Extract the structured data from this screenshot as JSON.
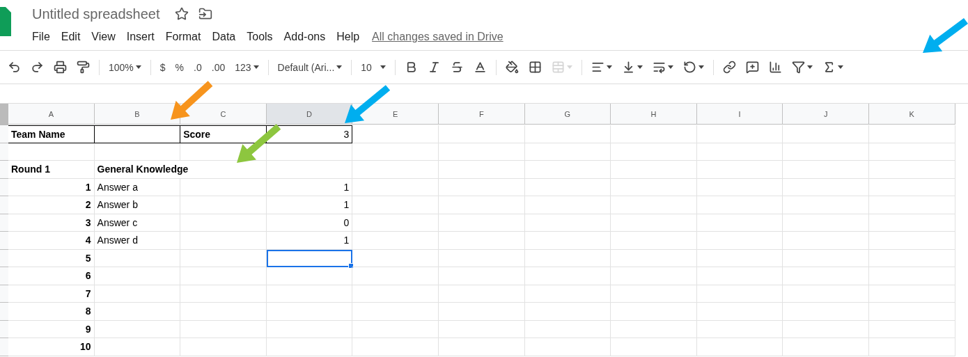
{
  "document": {
    "title": "Untitled spreadsheet",
    "save_status": "All changes saved in Drive"
  },
  "menu": [
    "File",
    "Edit",
    "View",
    "Insert",
    "Format",
    "Data",
    "Tools",
    "Add-ons",
    "Help"
  ],
  "toolbar": [
    {
      "items": [
        {
          "kind": "undo",
          "menu": false,
          "disabled": false
        },
        {
          "kind": "redo",
          "menu": false,
          "disabled": false
        },
        {
          "kind": "print",
          "menu": false,
          "disabled": false
        },
        {
          "kind": "paint-format",
          "menu": false,
          "disabled": false
        }
      ]
    },
    {
      "items": [
        {
          "kind": "select",
          "text": "100%",
          "menu": true,
          "disabled": false
        }
      ]
    },
    {
      "items": [
        {
          "kind": "text",
          "text": "$",
          "menu": false,
          "disabled": false
        },
        {
          "kind": "text",
          "text": "%",
          "menu": false,
          "disabled": false
        },
        {
          "kind": "decimal-less",
          "text": ".0",
          "menu": false,
          "disabled": false
        },
        {
          "kind": "decimal-more",
          "text": ".00",
          "menu": false,
          "disabled": false
        },
        {
          "kind": "text",
          "text": "123",
          "menu": true,
          "disabled": false
        }
      ]
    },
    {
      "items": [
        {
          "kind": "select",
          "text": "Default (Ari...",
          "menu": true,
          "disabled": false
        }
      ]
    },
    {
      "items": [
        {
          "kind": "select",
          "text": "10",
          "menu": true,
          "disabled": false
        }
      ]
    },
    {
      "items": [
        {
          "kind": "bold",
          "menu": false,
          "disabled": false
        },
        {
          "kind": "italic",
          "menu": false,
          "disabled": false
        },
        {
          "kind": "strikethrough",
          "menu": false,
          "disabled": false
        },
        {
          "kind": "text-color",
          "menu": false,
          "disabled": false
        }
      ]
    },
    {
      "items": [
        {
          "kind": "fill-color",
          "menu": false,
          "disabled": false
        },
        {
          "kind": "borders",
          "menu": false,
          "disabled": false
        },
        {
          "kind": "merge",
          "menu": true,
          "disabled": true
        }
      ]
    },
    {
      "items": [
        {
          "kind": "align",
          "menu": true,
          "disabled": false
        },
        {
          "kind": "valign",
          "menu": true,
          "disabled": false
        },
        {
          "kind": "wrap",
          "menu": true,
          "disabled": false
        },
        {
          "kind": "rotate",
          "menu": true,
          "disabled": false
        }
      ]
    },
    {
      "items": [
        {
          "kind": "link",
          "menu": false,
          "disabled": false
        },
        {
          "kind": "comment",
          "menu": false,
          "disabled": false
        },
        {
          "kind": "chart",
          "menu": false,
          "disabled": false
        },
        {
          "kind": "filter",
          "menu": true,
          "disabled": false
        },
        {
          "kind": "functions",
          "menu": true,
          "disabled": false
        }
      ]
    }
  ],
  "columns": [
    {
      "label": "A",
      "selected": false
    },
    {
      "label": "B",
      "selected": false
    },
    {
      "label": "C",
      "selected": false
    },
    {
      "label": "D",
      "selected": true
    },
    {
      "label": "E",
      "selected": false
    },
    {
      "label": "F",
      "selected": false
    },
    {
      "label": "G",
      "selected": false
    },
    {
      "label": "H",
      "selected": false
    },
    {
      "label": "I",
      "selected": false
    },
    {
      "label": "J",
      "selected": false
    },
    {
      "label": "K",
      "selected": false
    }
  ],
  "rows": [
    {
      "kind": "header",
      "a": "Team Name",
      "c": "Score",
      "d": "3",
      "selected": false
    },
    {
      "kind": "blank",
      "selected": false
    },
    {
      "kind": "section",
      "a": "Round 1",
      "b": "General Knowledge",
      "selected": false
    },
    {
      "kind": "item",
      "a": "1",
      "b": "Answer a",
      "d": "1",
      "selected": false
    },
    {
      "kind": "item",
      "a": "2",
      "b": "Answer b",
      "d": "1",
      "selected": false
    },
    {
      "kind": "item",
      "a": "3",
      "b": "Answer c",
      "d": "0",
      "selected": false
    },
    {
      "kind": "item",
      "a": "4",
      "b": "Answer d",
      "d": "1",
      "selected": false
    },
    {
      "kind": "item",
      "a": "5",
      "selected": true
    },
    {
      "kind": "item",
      "a": "6",
      "selected": false
    },
    {
      "kind": "item",
      "a": "7",
      "selected": false
    },
    {
      "kind": "item",
      "a": "8",
      "selected": false
    },
    {
      "kind": "item",
      "a": "9",
      "selected": false
    },
    {
      "kind": "item",
      "a": "10",
      "selected": false
    }
  ],
  "annotations": [
    {
      "color": "#f7941d"
    },
    {
      "color": "#00aeef"
    },
    {
      "color": "#8dc63f"
    },
    {
      "color": "#00aeef"
    }
  ]
}
